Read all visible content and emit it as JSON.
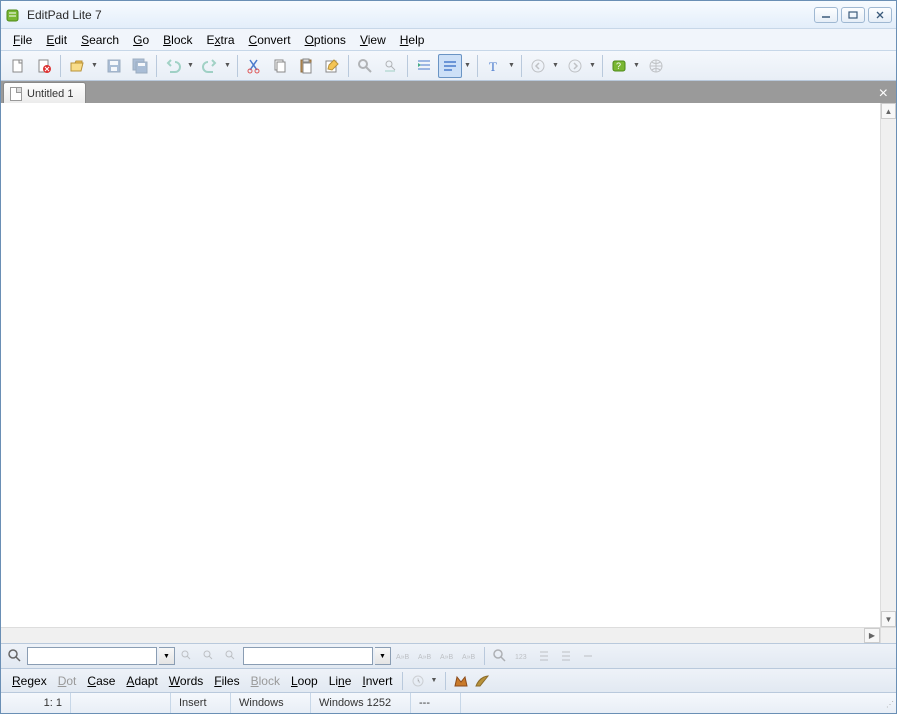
{
  "titlebar": {
    "title": "EditPad Lite 7"
  },
  "menu": {
    "file": "File",
    "edit": "Edit",
    "search": "Search",
    "go": "Go",
    "block": "Block",
    "extra": "Extra",
    "convert": "Convert",
    "options": "Options",
    "view": "View",
    "help": "Help"
  },
  "tabs": {
    "tab1": "Untitled 1"
  },
  "search": {
    "find_placeholder": "",
    "replace_placeholder": ""
  },
  "opts": {
    "regex": "Regex",
    "dot": "Dot",
    "case": "Case",
    "adapt": "Adapt",
    "words": "Words",
    "files": "Files",
    "block": "Block",
    "loop": "Loop",
    "line": "Line",
    "invert": "Invert"
  },
  "status": {
    "pos": "1: 1",
    "mode": "Insert",
    "eol": "Windows",
    "enc": "Windows 1252",
    "extra": "---"
  }
}
